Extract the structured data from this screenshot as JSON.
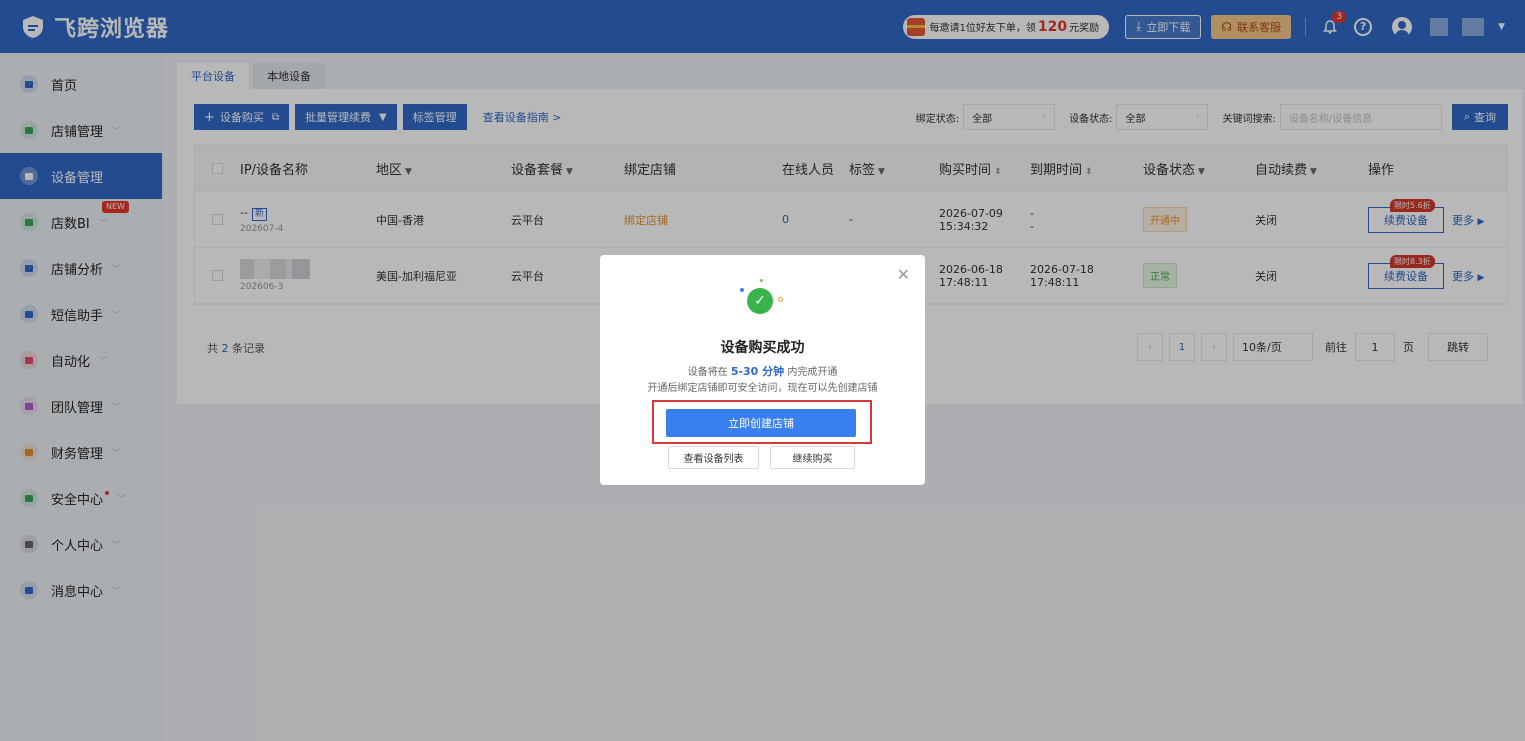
{
  "header": {
    "app_name": "飞跨浏览器",
    "invite_prefix": "每邀请1位好友下单，领",
    "invite_amount": "120",
    "invite_suffix": "元奖励",
    "download_label": "立即下载",
    "service_label": "联系客服",
    "notification_count": "3",
    "help_glyph": "?"
  },
  "sidebar": {
    "items": [
      {
        "label": "首页",
        "icon": "home-icon",
        "color": "#3068c8"
      },
      {
        "label": "店铺管理",
        "icon": "store-icon",
        "color": "#3aa856"
      },
      {
        "label": "设备管理",
        "icon": "device-icon",
        "color": "#3068c8",
        "active": true
      },
      {
        "label": "店数BI",
        "icon": "bi-icon",
        "color": "#3aa856",
        "tag": "NEW"
      },
      {
        "label": "店铺分析",
        "icon": "analysis-icon",
        "color": "#3068c8"
      },
      {
        "label": "短信助手",
        "icon": "sms-icon",
        "color": "#3068c8"
      },
      {
        "label": "自动化",
        "icon": "robot-icon",
        "color": "#e24c6b"
      },
      {
        "label": "团队管理",
        "icon": "team-icon",
        "color": "#b05cd0"
      },
      {
        "label": "财务管理",
        "icon": "wallet-icon",
        "color": "#e4922b"
      },
      {
        "label": "安全中心",
        "icon": "shield-icon",
        "color": "#3aa856",
        "dot": true
      },
      {
        "label": "个人中心",
        "icon": "user-icon",
        "color": "#666666"
      },
      {
        "label": "消息中心",
        "icon": "bell-icon",
        "color": "#3068c8"
      }
    ]
  },
  "tabs": [
    "平台设备",
    "本地设备"
  ],
  "toolbar": {
    "buy_label": "设备购买",
    "batch_label": "批量管理续费",
    "tag_label": "标签管理",
    "guide_label": "查看设备指南 >",
    "bind_status_label": "绑定状态:",
    "bind_status_value": "全部",
    "device_status_label": "设备状态:",
    "device_status_value": "全部",
    "keyword_label": "关键词搜索:",
    "keyword_placeholder": "设备名称/设备信息",
    "search_label": "查询"
  },
  "table": {
    "headers": [
      "IP/设备名称",
      "地区",
      "设备套餐",
      "绑定店铺",
      "在线人员",
      "标签",
      "购买时间",
      "到期时间",
      "设备状态",
      "自动续费",
      "操作"
    ],
    "rows": [
      {
        "name": "--",
        "new_tag": "新",
        "id": "202607-4",
        "region": "中国-香港",
        "plan": "云平台",
        "shop": "绑定店铺",
        "online": "0",
        "tag": "-",
        "buy_date": "2026-07-09",
        "buy_time": "15:34:32",
        "exp_date": "-",
        "exp_time": "-",
        "status": "开通中",
        "auto_renew": "关闭",
        "discount": "限时5.6折",
        "renew": "续费设备",
        "more": "更多"
      },
      {
        "name": "",
        "new_tag": "",
        "id": "202606-3",
        "region": "美国-加利福尼亚",
        "plan": "云平台",
        "shop": "",
        "online": "",
        "tag": "",
        "buy_date": "2026-06-18",
        "buy_time": "17:48:11",
        "exp_date": "2026-07-18",
        "exp_time": "17:48:11",
        "status": "正常",
        "auto_renew": "关闭",
        "discount": "限时8.3折",
        "renew": "续费设备",
        "more": "更多"
      }
    ]
  },
  "pagination": {
    "total_prefix": "共",
    "total_count": "2",
    "total_suffix": "条记录",
    "current_page": "1",
    "page_size": "10条/页",
    "goto_label": "前往",
    "goto_value": "1",
    "page_unit": "页",
    "jump_label": "跳转"
  },
  "modal": {
    "title": "设备购买成功",
    "line1_prefix": "设备将在",
    "line1_highlight": "5-30 分钟",
    "line1_suffix": "内完成开通",
    "line2": "开通后绑定店铺即可安全访问，现在可以先创建店铺",
    "create_label": "立即创建店铺",
    "list_label": "查看设备列表",
    "continue_label": "继续购买"
  },
  "colors": {
    "brand": "#3068c8",
    "success": "#3ab34a",
    "highlight_border": "#d8393b"
  }
}
